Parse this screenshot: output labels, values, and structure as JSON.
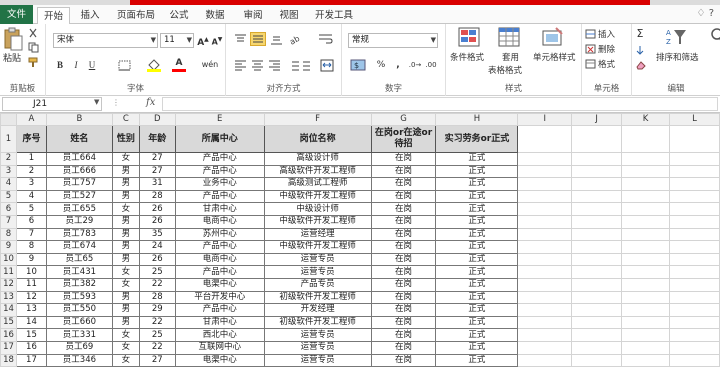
{
  "tabs": [
    "文件",
    "开始",
    "插入",
    "页面布局",
    "公式",
    "数据",
    "审阅",
    "视图",
    "开发工具"
  ],
  "ribbon": {
    "paste_label": "粘贴",
    "clipboard_label": "剪贴板",
    "font_name": "宋体",
    "font_size": "11",
    "font_label": "字体",
    "align_label": "对齐方式",
    "number_format": "常规",
    "number_label": "数字",
    "cond_format": "条件格式",
    "table_format_1": "套用",
    "table_format_2": "表格格式",
    "cell_style": "单元格样式",
    "style_label": "样式",
    "insert": "插入",
    "delete": "删除",
    "format": "格式",
    "cells_label": "单元格",
    "sort_filter": "排序和筛选",
    "find_select": "查找和选择",
    "edit_label": "编辑"
  },
  "formula_bar": {
    "name_box": "J21",
    "fx": "fx",
    "formula": ""
  },
  "columns": [
    "A",
    "B",
    "C",
    "D",
    "E",
    "F",
    "G",
    "H",
    "I",
    "J",
    "K",
    "L"
  ],
  "headers": [
    "序号",
    "姓名",
    "性别",
    "年龄",
    "所属中心",
    "岗位名称",
    "在岗or在途or待招",
    "实习劳务or正式"
  ],
  "rows": [
    [
      "1",
      "员工664",
      "女",
      "27",
      "产品中心",
      "高级设计师",
      "在岗",
      "正式"
    ],
    [
      "2",
      "员工666",
      "男",
      "27",
      "产品中心",
      "高级软件开发工程师",
      "在岗",
      "正式"
    ],
    [
      "3",
      "员工757",
      "男",
      "31",
      "业务中心",
      "高级测试工程师",
      "在岗",
      "正式"
    ],
    [
      "4",
      "员工527",
      "男",
      "28",
      "产品中心",
      "中级软件开发工程师",
      "在岗",
      "正式"
    ],
    [
      "5",
      "员工655",
      "女",
      "26",
      "甘肃中心",
      "中级设计师",
      "在岗",
      "正式"
    ],
    [
      "6",
      "员工29",
      "男",
      "26",
      "电商中心",
      "中级软件开发工程师",
      "在岗",
      "正式"
    ],
    [
      "7",
      "员工783",
      "男",
      "35",
      "苏州中心",
      "运营经理",
      "在岗",
      "正式"
    ],
    [
      "8",
      "员工674",
      "男",
      "24",
      "产品中心",
      "中级软件开发工程师",
      "在岗",
      "正式"
    ],
    [
      "9",
      "员工65",
      "男",
      "26",
      "电商中心",
      "运营专员",
      "在岗",
      "正式"
    ],
    [
      "10",
      "员工431",
      "女",
      "25",
      "产品中心",
      "运营专员",
      "在岗",
      "正式"
    ],
    [
      "11",
      "员工382",
      "女",
      "22",
      "电渠中心",
      "产品专员",
      "在岗",
      "正式"
    ],
    [
      "12",
      "员工593",
      "男",
      "28",
      "平台开发中心",
      "初级软件开发工程师",
      "在岗",
      "正式"
    ],
    [
      "13",
      "员工550",
      "男",
      "29",
      "产品中心",
      "开发经理",
      "在岗",
      "正式"
    ],
    [
      "14",
      "员工660",
      "男",
      "22",
      "甘肃中心",
      "初级软件开发工程师",
      "在岗",
      "正式"
    ],
    [
      "15",
      "员工331",
      "女",
      "25",
      "西北中心",
      "运营专员",
      "在岗",
      "正式"
    ],
    [
      "16",
      "员工69",
      "女",
      "22",
      "互联网中心",
      "运营专员",
      "在岗",
      "正式"
    ],
    [
      "17",
      "员工346",
      "女",
      "27",
      "电渠中心",
      "运营专员",
      "在岗",
      "正式"
    ]
  ]
}
